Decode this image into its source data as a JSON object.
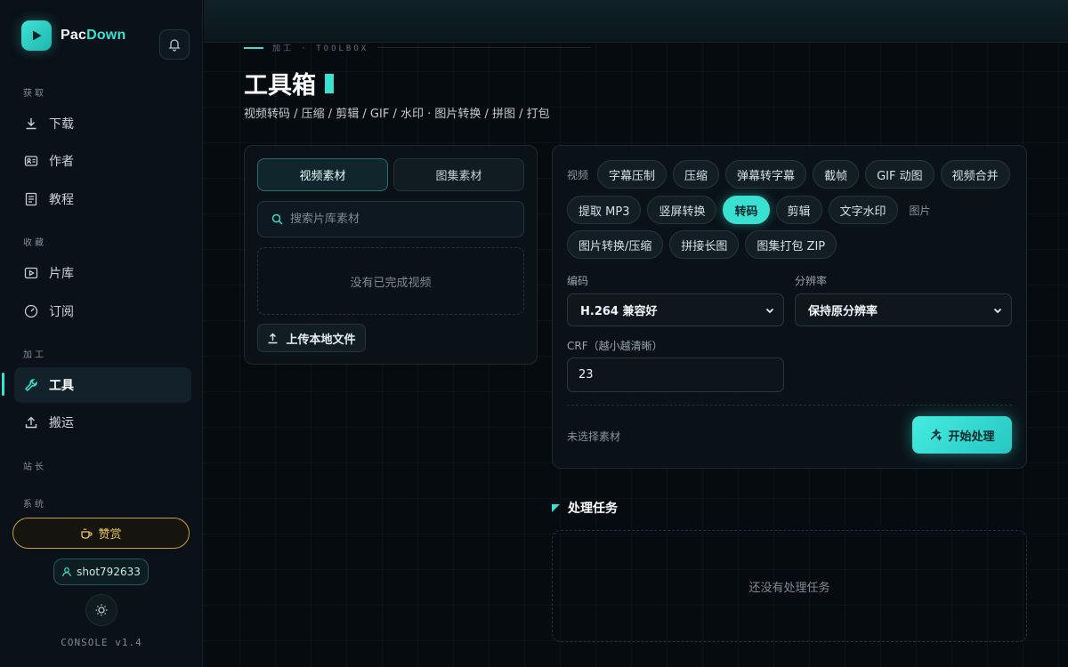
{
  "brand": {
    "prefix": "Pac",
    "suffix": "Down"
  },
  "sidebar": {
    "sections": {
      "fetch": "获取",
      "collect": "收藏",
      "process": "加工",
      "site": "站长",
      "system": "系统"
    },
    "items": [
      {
        "label": "下载",
        "icon": "download-icon"
      },
      {
        "label": "作者",
        "icon": "id-card-icon"
      },
      {
        "label": "教程",
        "icon": "book-icon"
      },
      {
        "label": "片库",
        "icon": "play-box-icon"
      },
      {
        "label": "订阅",
        "icon": "gauge-icon"
      },
      {
        "label": "工具",
        "icon": "wrench-icon",
        "active": true
      },
      {
        "label": "搬运",
        "icon": "upload-icon"
      }
    ],
    "donate_label": "赞赏",
    "username": "shot792633",
    "version": "CONSOLE v1.4"
  },
  "header": {
    "kicker": "加工 · TOOLBOX",
    "title": "工具箱",
    "subtitle": "视频转码 / 压缩 / 剪辑 / GIF / 水印 · 图片转换 / 拼图 / 打包"
  },
  "materials": {
    "tabs": [
      {
        "label": "视频素材",
        "active": true
      },
      {
        "label": "图集素材",
        "active": false
      }
    ],
    "search_placeholder": "搜索片库素材",
    "empty_text": "没有已完成视频",
    "upload_label": "上传本地文件"
  },
  "tools": {
    "video_label": "视频",
    "image_label": "图片",
    "video_tools": [
      "字幕压制",
      "压缩",
      "弹幕转字幕",
      "截帧",
      "GIF 动图",
      "视频合并",
      "提取 MP3",
      "竖屏转换",
      "转码",
      "剪辑",
      "文字水印"
    ],
    "image_tools": [
      "图片转换/压缩",
      "拼接长图",
      "图集打包 ZIP"
    ],
    "active_tool": "转码",
    "codec_label": "编码",
    "codec_value": "H.264 兼容好",
    "resolution_label": "分辨率",
    "resolution_value": "保持原分辨率",
    "crf_label": "CRF（越小越清晰）",
    "crf_value": "23",
    "status_text": "未选择素材",
    "start_label": "开始处理"
  },
  "tasks": {
    "title": "处理任务",
    "empty_text": "还没有处理任务"
  },
  "colors": {
    "accent": "#38e1d1",
    "gold": "#f0c75a",
    "background": "#060b10"
  }
}
